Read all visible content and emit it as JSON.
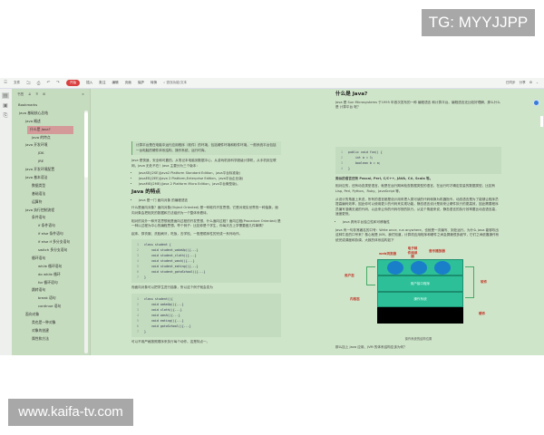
{
  "watermarks": {
    "top_right": "TG: MYYJJPP",
    "bottom_left": "www.kaifa-tv.com"
  },
  "toolbar": {
    "file": "文件",
    "tabs": [
      "开始",
      "插入",
      "批注",
      "编辑",
      "页面",
      "保护",
      "转换"
    ],
    "active_tab": "开始",
    "search_placeholder": "查找功能/文本",
    "sync": "已同步",
    "share": "分享"
  },
  "sidebar": {
    "title": "书签",
    "bookmarks_label": "Bookmarks",
    "items": [
      {
        "label": "Java 基础核心总结",
        "level": 0
      },
      {
        "label": "Java 概述",
        "level": 1
      },
      {
        "label": "什么是 Java?",
        "level": 2,
        "selected": true
      },
      {
        "label": "Java 的特点",
        "level": 2
      },
      {
        "label": "Java 开发环境",
        "level": 1
      },
      {
        "label": "JDK",
        "level": 3
      },
      {
        "label": "JRE",
        "level": 3
      },
      {
        "label": "Java 开发环境配置",
        "level": 1
      },
      {
        "label": "Java 基本语法",
        "level": 1
      },
      {
        "label": "数据类型",
        "level": 2
      },
      {
        "label": "基础语法",
        "level": 2
      },
      {
        "label": "运算符",
        "level": 2
      },
      {
        "label": "Java 执行控制流程",
        "level": 1
      },
      {
        "label": "条件语句",
        "level": 2
      },
      {
        "label": "if 条件语句",
        "level": 3
      },
      {
        "label": "if else 条件语句",
        "level": 3
      },
      {
        "label": "if else if 多分支语句",
        "level": 3
      },
      {
        "label": "switch 多分支语句",
        "level": 3
      },
      {
        "label": "循环语句",
        "level": 2
      },
      {
        "label": "while 循环语句",
        "level": 3
      },
      {
        "label": "do while 循环",
        "level": 3
      },
      {
        "label": "for 循环语句",
        "level": 3
      },
      {
        "label": "跳转语句",
        "level": 2
      },
      {
        "label": "break 语句",
        "level": 3
      },
      {
        "label": "continue 语句",
        "level": 3
      },
      {
        "label": "面向对象",
        "level": 1
      },
      {
        "label": "类也是一种对象",
        "level": 2
      },
      {
        "label": "对象的创建",
        "level": 2
      },
      {
        "label": "属性和方法",
        "level": 2
      }
    ]
  },
  "left_page": {
    "quote": "计算平台是在电脑中运行应用程序（软件）的环境，包括硬件环境和软件环境，一般系统平台包括一台电脑的硬件体系结构、操作系统、运行时库。",
    "intro": "Java 是快速，安全和可靠的。从笔记本电脑到数据中心，从游戏机到科学超级计算机，从手机到互联网，Java 无处不在！Java 主要分为三个版本：",
    "editions": [
      "JavaSE(J2SE)(Java2 Platform Standard Edition，java平台标准版)",
      "JavaEE(J2EE)(Java 2 Platform,Enterprise Edition，java平台企业版)",
      "JavaME(J2ME)(Java 2 Platform Micro Edition，java平台微型版)。"
    ],
    "features_title": "Java 的特点",
    "feature1": "Java 是一门 面向对象 的编程语言",
    "oop_p1": "什么是面向对象？面向对象(Object Oriented) 是一种软件开发思想。它是对现实世界的一种抽象，面向对象会把相关的数据和方法组织为一个整体来看待。",
    "oop_p2": "相对的另外一种开发思想就是面向过程的开发思想，什么面向过程？面向过程(Procedure Oriented) 是一种以过程为中心的编程思想。举个例子：比如你是个学生，你每天去上学需要做几件事情？",
    "oop_p3": "起床、穿衣服、洗脸刷牙，吃饭，去学校。一般是顺序性的完成一系列动作。",
    "code1": [
      "class student {",
      "    void student_wakeUp(){...}",
      "    void student_cloth(){...}",
      "    void student_wash(){...}",
      "    void student_eating(){...}",
      "    void student_gotoSchool(){...}",
      "}"
    ],
    "oop_p4": "而面向对象可以把学生进行抽象，所以这个例子就会变为",
    "code2": [
      "class student(){",
      "    void wakeUp(){...}",
      "    void cloth(){...}",
      "    void wash(){...}",
      "    void eating(){...}",
      "    void gotoSchool(){...}",
      "}"
    ],
    "oop_p5": "可以不用严格按照顺序来执行每个动作。这是特点一。"
  },
  "right_page": {
    "title": "什么是 Java?",
    "intro": "Java 是 Sun Microsystems 于1995 年首次发布的一种 编程语言 和计算平台。编程语言还比较好理解，那么什么是 计算平台 呢？",
    "code": [
      "public void fun() {",
      "    int a = 1;",
      "    boolean b = a;",
      "}"
    ],
    "p1": "类似的语言还有 Pascal, Perl, C/C++, JAVA, C#, Scala 等。",
    "p2": "相对应的，还有动态类型语言，就是在运行期间检查数据类型的语言，在运行时才确定变量的数据类型，比如有Lisp, Perl, Python、Ruby、JavaScript 等。",
    "p3": "从设计的角度上来说，所有的语言都是设计用来把人类可读的代码转换为机器指令。动态语言是为了能够让程序员提高编码效率，因此你可以使用更少的代码来实现功能。静态语言设计是用来让硬件执行的更高效，因此需要程序员编写准确无误的代码，以此来让你的代码尽快的执行。从这个角度来说，静态语言的执行效率要比动态语言高，速度更快。",
    "bullet": "Java 具有平台独立性和可移植性",
    "p4": "Java 有一句非常著名的口号：Write once, run anywhere，也就是一次编写、到处运行。为什么 Java 能够吹出这种牛皮的口号来？核心就是 JVM。我们知道，计算机应用程序和硬件之间会屏蔽很多细节，它们之间依靠操作系统完成调度和协调，大致的体系结构如下",
    "diagram": {
      "apps": [
        "web浏览器",
        "电子邮件阅读器",
        "音乐播放器"
      ],
      "user_mode": "用户态",
      "kernel_mode": "内核态",
      "software": "软件",
      "hardware": "硬件",
      "layer_ui": "用户接口程序",
      "layer_os": "操作系统"
    },
    "caption": "操作系统的结构位置",
    "p5": "那么加上 Java 应用、JVM 的体系结构应该为何？"
  },
  "colors": {
    "background": "#cfe5c9",
    "active_tab": "#d9403f",
    "selected_bookmark": "#d49a9a",
    "diagram_layer": "#2dbf98",
    "diagram_circle": "#1a7fc9",
    "highlight": "#c0772a"
  }
}
